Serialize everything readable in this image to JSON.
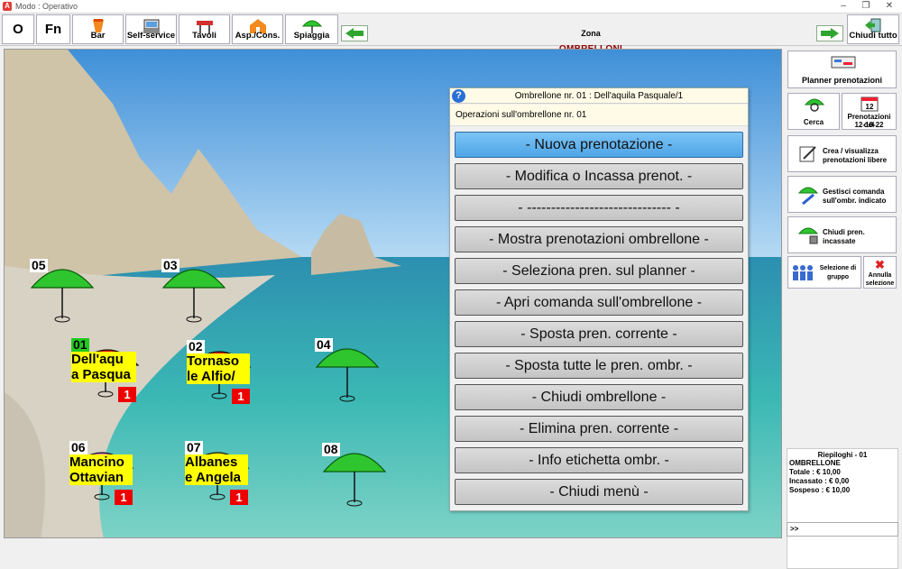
{
  "window": {
    "title": "Modo : Operativo",
    "app_icon": "A"
  },
  "toolbar": {
    "btn_o": "O",
    "btn_fn": "Fn",
    "items": [
      {
        "label": "Bar",
        "icon": "drink-icon"
      },
      {
        "label": "Self-service",
        "icon": "register-icon"
      },
      {
        "label": "Tavoli",
        "icon": "table-icon"
      },
      {
        "label": "Asp./Cons.",
        "icon": "takeaway-icon"
      },
      {
        "label": "Spiaggia",
        "icon": "umbrella-icon"
      }
    ],
    "zone_label": "Zona",
    "zone_name": "OMBRELLONI",
    "close_all": "Chiudi tutto"
  },
  "umbrellas": [
    {
      "num": "05",
      "color": "#2ec52e"
    },
    {
      "num": "03",
      "color": "#2ec52e"
    },
    {
      "num": "01",
      "color": "#e01010",
      "line1": "Dell'aqu",
      "line2": "a Pasqua",
      "badge": "1"
    },
    {
      "num": "02",
      "color": "#e01010",
      "line1": "Tornaso",
      "line2": "le Alfio/",
      "badge": "1"
    },
    {
      "num": "04",
      "color": "#2ec52e"
    },
    {
      "num": "06",
      "color": "#e070d0",
      "line1": "Mancino",
      "line2": "Ottavian",
      "badge": "1"
    },
    {
      "num": "07",
      "color": "#ffee00",
      "line1": "Albanes",
      "line2": "e Angela",
      "badge": "1"
    },
    {
      "num": "08",
      "color": "#2ec52e"
    }
  ],
  "popup": {
    "title": "Ombrellone nr. 01 : Dell'aquila Pasquale/1",
    "subtitle": "Operazioni sull'ombrellone nr. 01",
    "items": [
      "-    Nuova prenotazione    -",
      "-    Modifica o Incassa prenot.    -",
      "-    ------------------------------    -",
      "-  Mostra prenotazioni ombrellone  -",
      "-    Seleziona pren. sul planner    -",
      "-  Apri comanda sull'ombrellone  -",
      "-    Sposta pren. corrente    -",
      "-   Sposta tutte le pren. ombr.   -",
      "-    Chiudi ombrellone    -",
      "-    Elimina pren. corrente    -",
      "-    Info etichetta ombr.    -",
      "-    Chiudi menù    -"
    ]
  },
  "sidebar": {
    "planner": "Planner prenotazioni",
    "cerca": "Cerca",
    "prenotazioni_del": "Prenotazioni del",
    "prenotazioni_date": "12-10-22",
    "calendar_day": "12",
    "crea_line1": "Crea / visualizza",
    "crea_line2": "prenotazioni libere",
    "gestisci_line1": "Gestisci comanda",
    "gestisci_line2": "sull'ombr. indicato",
    "chiudi_line1": "Chiudi pren.",
    "chiudi_line2": "incassate",
    "selezione_line1": "Selezione di",
    "selezione_line2": "gruppo",
    "annulla_line1": "Annulla",
    "annulla_line2": "selezione"
  },
  "summary": {
    "header": "Riepiloghi - 01",
    "lines": [
      "OMBRELLONE",
      "Totale : € 10,00",
      "Incassato : € 0,00",
      "Sospeso : € 10,00"
    ]
  },
  "command_prompt": ">>"
}
